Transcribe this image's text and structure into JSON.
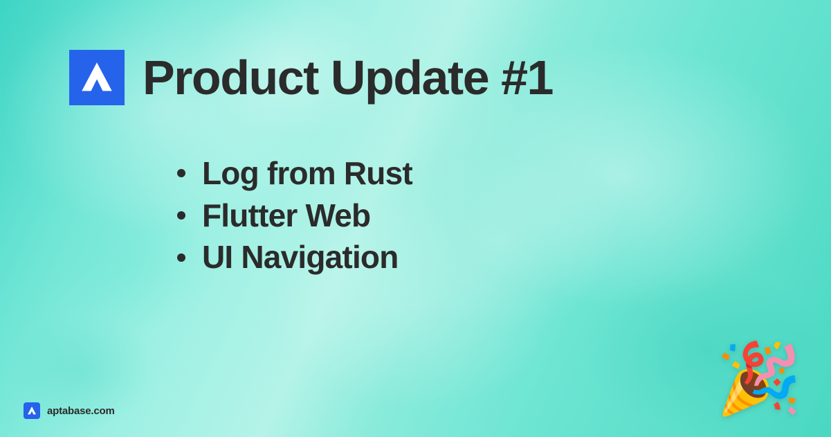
{
  "header": {
    "title": "Product Update #1"
  },
  "features": {
    "items": [
      "Log from Rust",
      "Flutter Web",
      "UI Navigation"
    ]
  },
  "footer": {
    "brand": "aptabase.com"
  },
  "decor": {
    "party_emoji": "🎉"
  }
}
